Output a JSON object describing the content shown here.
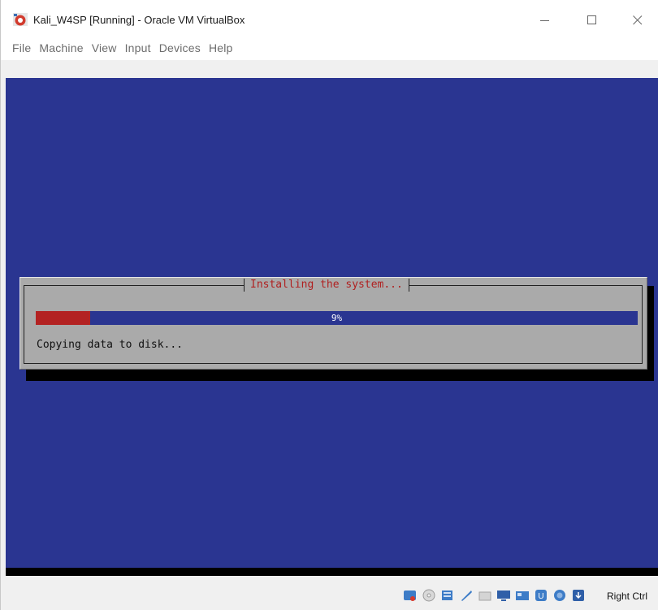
{
  "window": {
    "title": "Kali_W4SP [Running] - Oracle VM VirtualBox",
    "icon": "virtualbox-icon"
  },
  "menu": [
    "File",
    "Machine",
    "View",
    "Input",
    "Devices",
    "Help"
  ],
  "installer": {
    "dialog_title": "Installing the system...",
    "progress_percent": 9,
    "progress_label": "9%",
    "status_message": "Copying data to disk...",
    "colors": {
      "background": "#2a3591",
      "dialog": "#aaaaaa",
      "progress_fill": "#b32222",
      "title_text": "#b02020"
    }
  },
  "statusbar": {
    "icons": [
      "hard-disk-icon",
      "optical-drive-icon",
      "audio-icon",
      "usb-icon",
      "shared-folders-icon",
      "display-icon",
      "network-icon",
      "recording-icon",
      "mouse-integration-icon",
      "host-key-icon"
    ],
    "host_key_label": "Right Ctrl"
  }
}
